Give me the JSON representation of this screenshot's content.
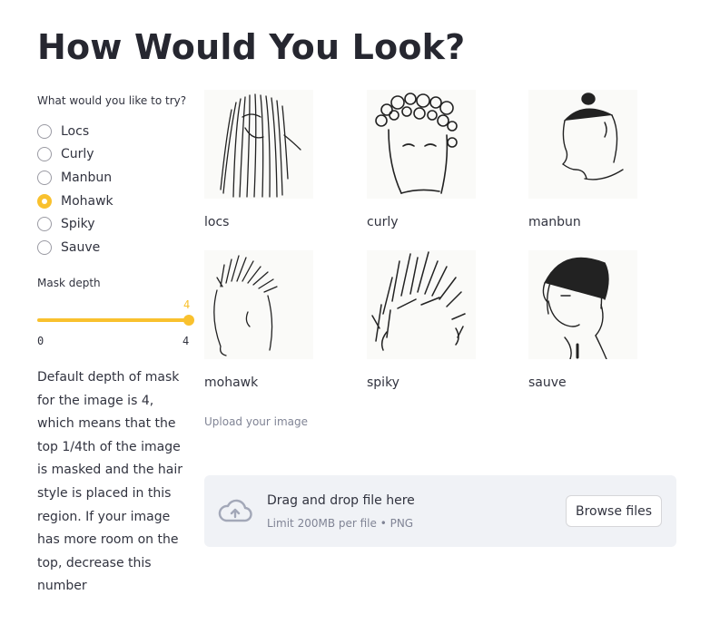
{
  "page": {
    "title": "How Would You Look?"
  },
  "style_picker": {
    "label": "What would you like to try?",
    "options": [
      "Locs",
      "Curly",
      "Manbun",
      "Mohawk",
      "Spiky",
      "Sauve"
    ],
    "selected": "Mohawk"
  },
  "mask_slider": {
    "label": "Mask depth",
    "value": "4",
    "min": "0",
    "max": "4",
    "fill_fraction": 1.0,
    "accent_color": "#f9c12e"
  },
  "description": "Default depth of mask for the image is 4, which means that the top 1/4th of the image is masked and the hair style is placed in this region. If your image has more room on the top, decrease this number",
  "gallery": [
    {
      "caption": "locs",
      "icon": "locs-hairstyle-image"
    },
    {
      "caption": "curly",
      "icon": "curly-hairstyle-image"
    },
    {
      "caption": "manbun",
      "icon": "manbun-hairstyle-image"
    },
    {
      "caption": "mohawk",
      "icon": "mohawk-hairstyle-image"
    },
    {
      "caption": "spiky",
      "icon": "spiky-hairstyle-image"
    },
    {
      "caption": "sauve",
      "icon": "sauve-hairstyle-image"
    }
  ],
  "uploader": {
    "label": "Upload your image",
    "drop_title": "Drag and drop file here",
    "limit": "Limit 200MB per file • PNG",
    "button": "Browse files",
    "icon": "cloud-upload-icon"
  }
}
